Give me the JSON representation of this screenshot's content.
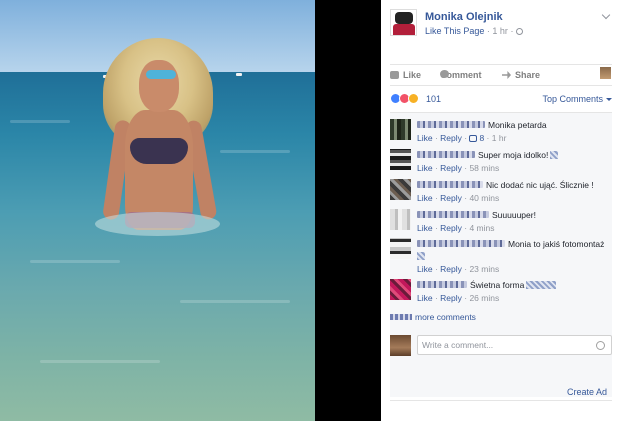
{
  "post": {
    "page_name": "Monika Olejnik",
    "like_page_label": "Like This Page",
    "time": "1 hr",
    "separator": "·"
  },
  "actions": {
    "like": "Like",
    "comment": "Comment",
    "share": "Share"
  },
  "reactions": {
    "count": "101",
    "sort_label": "Top Comments",
    "colors": {
      "like": "#4080ff",
      "love": "#f25268",
      "wow": "#f7b125"
    }
  },
  "comments": [
    {
      "text": "Monika petarda",
      "like": "Like",
      "reply": "Reply",
      "likes": "8",
      "time": "1 hr"
    },
    {
      "text": "Super moja idolko!",
      "like": "Like",
      "reply": "Reply",
      "time": "58 mins"
    },
    {
      "text": "Nic dodać nic ująć. Ślicznie !",
      "like": "Like",
      "reply": "Reply",
      "time": "40 mins"
    },
    {
      "text": "Suuuuuper!",
      "like": "Like",
      "reply": "Reply",
      "time": "4 mins"
    },
    {
      "text": "Monia to jakiś fotomontaż",
      "like": "Like",
      "reply": "Reply",
      "time": "23 mins"
    },
    {
      "text": "Świetna forma",
      "like": "Like",
      "reply": "Reply",
      "time": "26 mins"
    }
  ],
  "more_comments": "more comments",
  "write_comment": {
    "placeholder": "Write a comment..."
  },
  "create_ad": "Create Ad",
  "icons": [
    "chevron-down-icon",
    "globe-icon",
    "like-icon",
    "comment-icon",
    "share-icon",
    "smiley-icon"
  ]
}
